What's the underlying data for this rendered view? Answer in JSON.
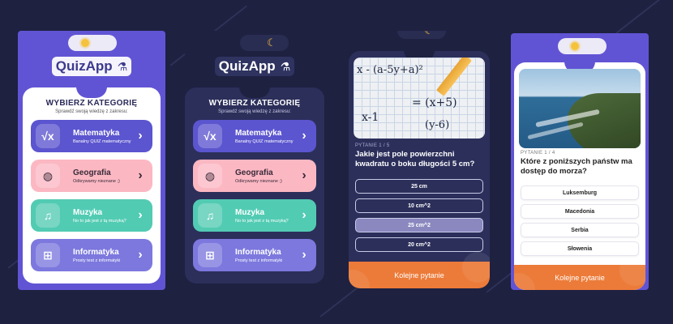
{
  "screens": {
    "light_categories": {
      "theme_icon": "sun-icon",
      "logo_text": "QuizApp",
      "title": "WYBIERZ KATEGORIĘ",
      "subtitle": "Sprawdź swoją wiedzę z zakresu:",
      "categories": [
        {
          "name": "Matematyka",
          "desc": "Banalny QUIZ matematyczny",
          "icon": "sqrt-x-icon",
          "color": "#5b55cf"
        },
        {
          "name": "Geografia",
          "desc": "Odkrywamy nieznane ;)",
          "icon": "globe-icon",
          "color": "#fbb8c3"
        },
        {
          "name": "Muzyka",
          "desc": "No to jak jest z tą muzyką?",
          "icon": "music-note-icon",
          "color": "#52cbb3"
        },
        {
          "name": "Informatyka",
          "desc": "Prosty test z informatyki",
          "icon": "network-icon",
          "color": "#7c78de"
        }
      ]
    },
    "dark_categories": {
      "theme_icon": "moon-icon",
      "logo_text": "QuizApp",
      "title": "WYBIERZ KATEGORIĘ",
      "subtitle": "Sprawdź swoją wiedzę z zakresu:",
      "categories": [
        {
          "name": "Matematyka",
          "desc": "Banalny QUIZ matematyczny",
          "icon": "sqrt-x-icon",
          "color": "#5b55cf"
        },
        {
          "name": "Geografia",
          "desc": "Odkrywamy nieznane ;)",
          "icon": "globe-icon",
          "color": "#fbb8c3"
        },
        {
          "name": "Muzyka",
          "desc": "No to jak jest z tą muzyką?",
          "icon": "music-note-icon",
          "color": "#52cbb3"
        },
        {
          "name": "Informatyka",
          "desc": "Prosty test z informatyki",
          "icon": "network-icon",
          "color": "#7c78de"
        }
      ]
    },
    "dark_question": {
      "question_number": "PYTANIE 1 / 5",
      "question": "Jakie jest pole powierzchni kwadratu o boku długości 5 cm?",
      "answers": [
        "25 cm",
        "10 cm^2",
        "25 cm^2",
        "20 cm^2"
      ],
      "selected_index": 2,
      "next_label": "Kolejne pytanie",
      "image_alt": "math-equation-photo",
      "image_text": {
        "a": "x - (a-5y+a)²",
        "b": "= (x+5)",
        "c": "x-1",
        "d": "(y-6)"
      }
    },
    "light_question": {
      "theme_icon": "sun-icon",
      "question_number": "PYTANIE 1 / 4",
      "question": "Które z poniższych państw ma dostęp do morza?",
      "answers": [
        "Luksemburg",
        "Macedonia",
        "Serbia",
        "Słowenia"
      ],
      "next_label": "Kolejne pytanie",
      "image_alt": "coastline-photo"
    }
  },
  "colors": {
    "background": "#1e2140",
    "accent_purple": "#6154d4",
    "dark_panel": "#2c2f5a",
    "orange": "#ec7b39"
  }
}
